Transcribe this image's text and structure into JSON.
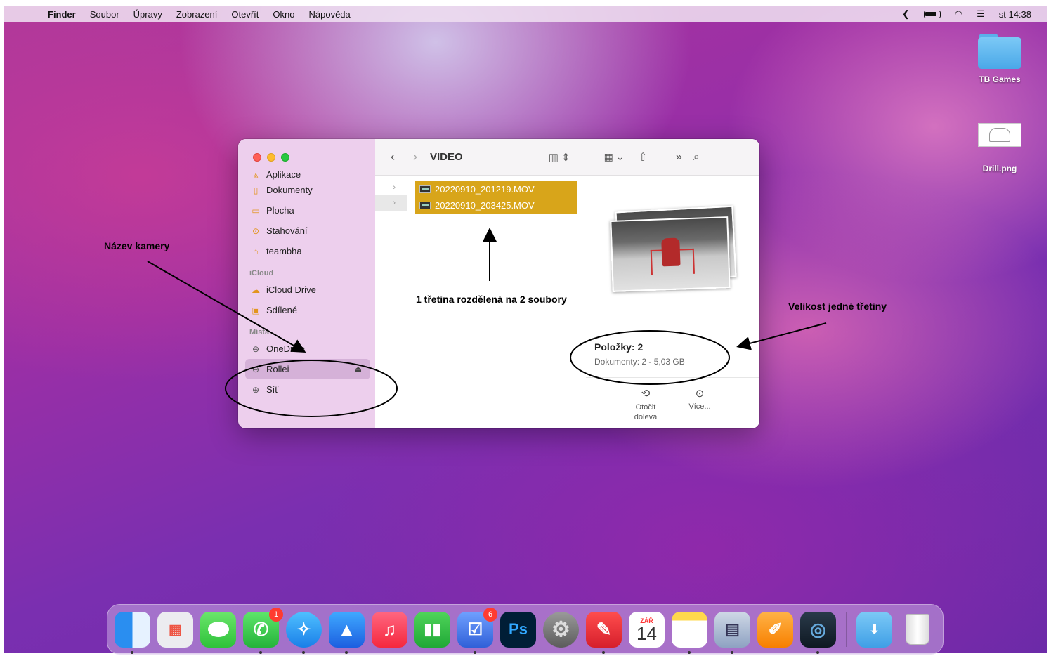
{
  "menubar": {
    "app": "Finder",
    "items": [
      "Soubor",
      "Úpravy",
      "Zobrazení",
      "Otevřít",
      "Okno",
      "Nápověda"
    ],
    "clock": "st 14:38"
  },
  "desktop": {
    "icons": [
      {
        "label": "TB Games",
        "kind": "folder-icon"
      },
      {
        "label": "Drill.png",
        "kind": "image-file-icon"
      }
    ]
  },
  "finder": {
    "title": "VIDEO",
    "sidebar": {
      "items_top": [
        {
          "label": "Aplikace",
          "icon": "apps-icon"
        },
        {
          "label": "Dokumenty",
          "icon": "document-icon"
        },
        {
          "label": "Plocha",
          "icon": "desktop-icon"
        },
        {
          "label": "Stahování",
          "icon": "download-icon"
        },
        {
          "label": "teambha",
          "icon": "home-icon"
        }
      ],
      "section_icloud": "iCloud",
      "items_icloud": [
        {
          "label": "iCloud Drive",
          "icon": "cloud-icon"
        },
        {
          "label": "Sdílené",
          "icon": "shared-folder-icon"
        }
      ],
      "section_places": "Místa",
      "items_places": [
        {
          "label": "OneDrive",
          "icon": "drive-icon"
        },
        {
          "label": "Rollei",
          "icon": "drive-icon",
          "selected": true
        },
        {
          "label": "Síť",
          "icon": "network-icon"
        }
      ]
    },
    "files": [
      "20220910_201219.MOV",
      "20220910_203425.MOV"
    ],
    "info": {
      "title": "Položky: 2",
      "subtitle": "Dokumenty: 2 - 5,03 GB"
    },
    "actions": [
      {
        "label": "Otočit doleva",
        "icon": "rotate-left-icon"
      },
      {
        "label": "Více...",
        "icon": "more-icon"
      }
    ]
  },
  "annotations": {
    "camera_name": "Název kamery",
    "split": "1 třetina rozdělená na 2 soubory",
    "size": "Velikost jedné třetiny"
  },
  "dock": {
    "badges": {
      "whatsapp": "1",
      "reminders": "6"
    },
    "calendar_month": "ZÁŘ",
    "calendar_day": "14",
    "photoshop_label": "Ps"
  }
}
